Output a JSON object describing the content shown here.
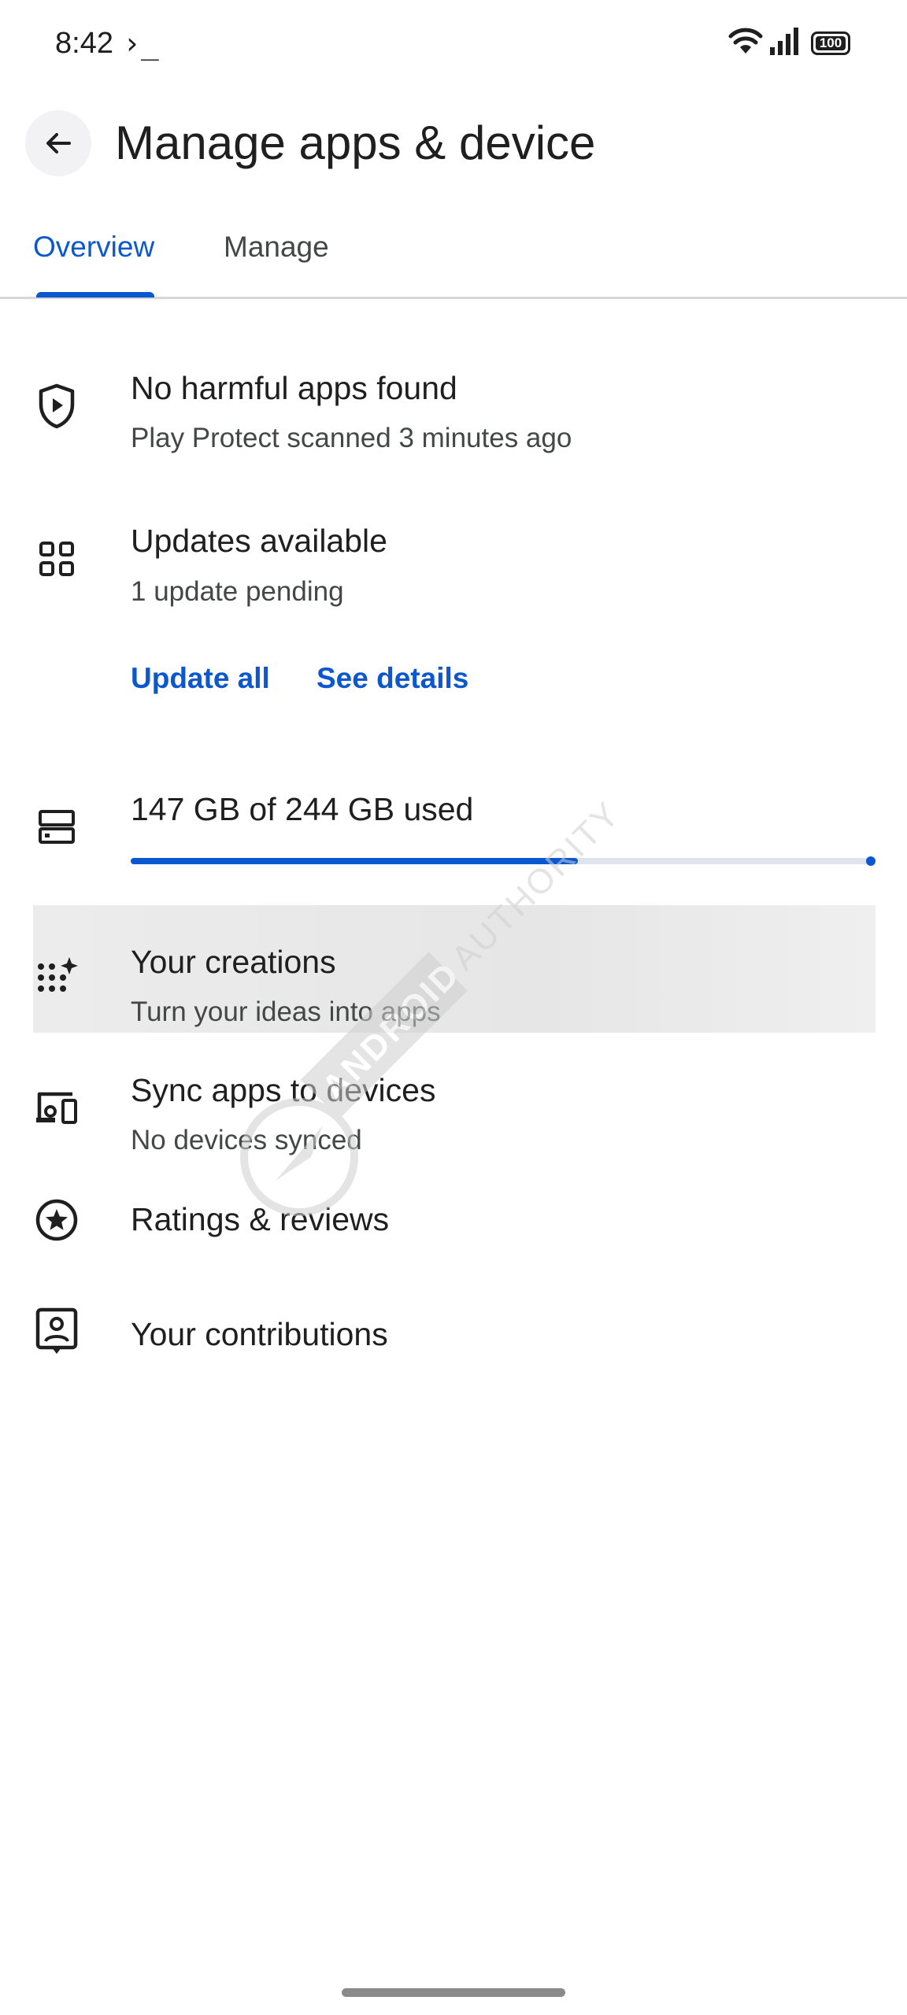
{
  "status_bar": {
    "time": "8:42",
    "terminal_glyph": "›_",
    "battery": "100",
    "wifi_icon": "wifi-icon",
    "signal_icon": "signal-icon"
  },
  "header": {
    "title": "Manage apps & device",
    "back_icon": "arrow-back-icon"
  },
  "tabs": [
    {
      "label": "Overview",
      "selected": true
    },
    {
      "label": "Manage",
      "selected": false
    }
  ],
  "protect": {
    "icon": "shield-play-icon",
    "title": "No harmful apps found",
    "subtitle": "Play Protect scanned 3 minutes ago"
  },
  "updates": {
    "icon": "apps-grid-icon",
    "title": "Updates available",
    "subtitle": "1 update pending",
    "update_all_label": "Update all",
    "see_details_label": "See details"
  },
  "storage": {
    "icon": "storage-icon",
    "label": "147 GB of 244 GB used",
    "used_fraction": 0.6
  },
  "creations": {
    "icon": "sparkle-dots-icon",
    "title": "Your creations",
    "subtitle": "Turn your ideas into apps"
  },
  "sync": {
    "icon": "devices-icon",
    "title": "Sync apps to devices",
    "subtitle": "No devices synced"
  },
  "ratings": {
    "icon": "star-circle-icon",
    "title": "Ratings & reviews"
  },
  "contributions": {
    "icon": "account-box-icon",
    "title": "Your contributions"
  },
  "watermark": {
    "text": "ANDROID AUTHORITY"
  },
  "colors": {
    "accent": "#0b57d0",
    "text_primary": "#1f1f1f",
    "text_secondary": "#444746"
  }
}
